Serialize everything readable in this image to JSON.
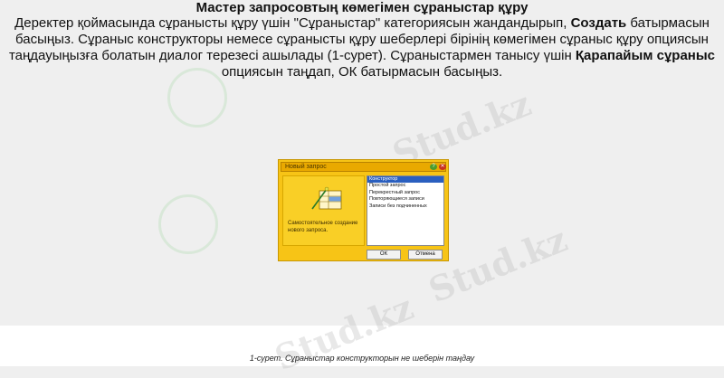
{
  "heading": "Мастер запросовтың көмегімен сұраныстар құру",
  "paragraph": {
    "part1": "Деректер қоймасында сұранысты құру үшін \"Сұраныстар\" категориясын жандандырып, ",
    "bold1": "Создать",
    "part2": " батырмасын басыңыз. Сұраныс конструкторы немесе сұранысты құру шеберлері бірінің көмегімен сұраныс құру опциясын таңдауыңызға болатын диалог терезесі ашылады (1-сурет). Сұраныстармен танысу үшін ",
    "bold2": "Қарапайым сұраныс",
    "part3": " опциясын таңдап, ОК батырмасын басыңыз."
  },
  "dialog": {
    "title": "Новый запрос",
    "description": "Самостоятельное создание нового запроса.",
    "list_items": [
      "Конструктор",
      "Простой запрос",
      "Перекрестный запрос",
      "Повторяющиеся записи",
      "Записи без подчиненных"
    ],
    "selected_index": 0,
    "ok_label": "ОК",
    "cancel_label": "Отмена",
    "help_glyph": "?",
    "close_glyph": "✕"
  },
  "caption": "1-сурет. Сұраныстар конструкторын не шеберін таңдау",
  "watermark_text": "Stud.kz",
  "colors": {
    "dialog_bg": "#f7c416",
    "titlebar": "#e9a900",
    "selection": "#2a5fbf"
  }
}
